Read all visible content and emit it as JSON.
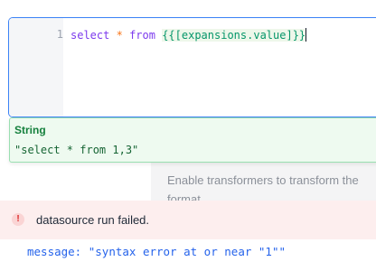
{
  "editor": {
    "line_number": "1",
    "tokens": {
      "select": "select",
      "star": "*",
      "from": "from",
      "template": "{{[expansions.value]}}"
    }
  },
  "evaluation": {
    "type": "String",
    "value": "\"select * from 1,3\""
  },
  "background_panel": {
    "line1": "Enable transformers to transform the",
    "line2": "format"
  },
  "error": {
    "icon": "!",
    "title": "datasource run failed."
  },
  "error_detail": {
    "key": "message:",
    "value": "\"syntax error at or near \"1\"\""
  }
}
